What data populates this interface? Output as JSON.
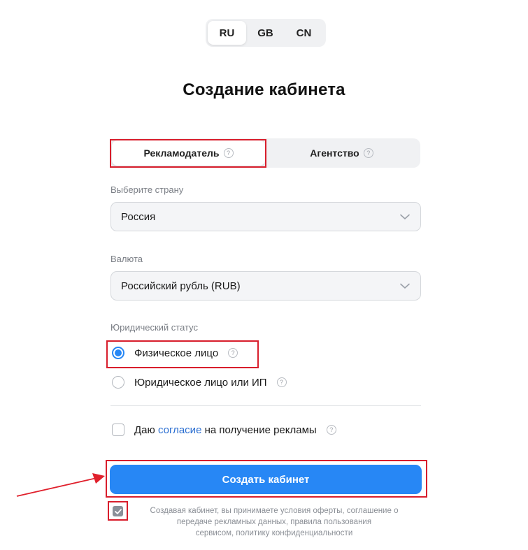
{
  "lang_switch": {
    "options": [
      "RU",
      "GB",
      "CN"
    ],
    "active": "RU"
  },
  "page_title": "Создание кабинета",
  "tabs": [
    {
      "label": "Рекламодатель",
      "active": true
    },
    {
      "label": "Агентство",
      "active": false
    }
  ],
  "country": {
    "label": "Выберите страну",
    "value": "Россия"
  },
  "currency": {
    "label": "Валюта",
    "value": "Российский рубль (RUB)"
  },
  "legal_status": {
    "label": "Юридический статус",
    "options": [
      {
        "label": "Физическое лицо",
        "checked": true
      },
      {
        "label": "Юридическое лицо или ИП",
        "checked": false
      }
    ]
  },
  "consent": {
    "prefix": "Даю",
    "link": "согласие",
    "suffix": "на получение рекламы",
    "checked": false
  },
  "submit_label": "Создать кабинет",
  "terms": {
    "checked": true,
    "line1": "Создавая кабинет, вы принимаете условия оферты, соглашение о",
    "line2": "передаче рекламных данных, правила пользования",
    "line3": "сервисом, политику конфиденциальности"
  },
  "icons": {
    "help": "?"
  },
  "colors": {
    "accent": "#2787f5",
    "highlight_box": "#d81e2c",
    "link": "#2a6ed1"
  }
}
